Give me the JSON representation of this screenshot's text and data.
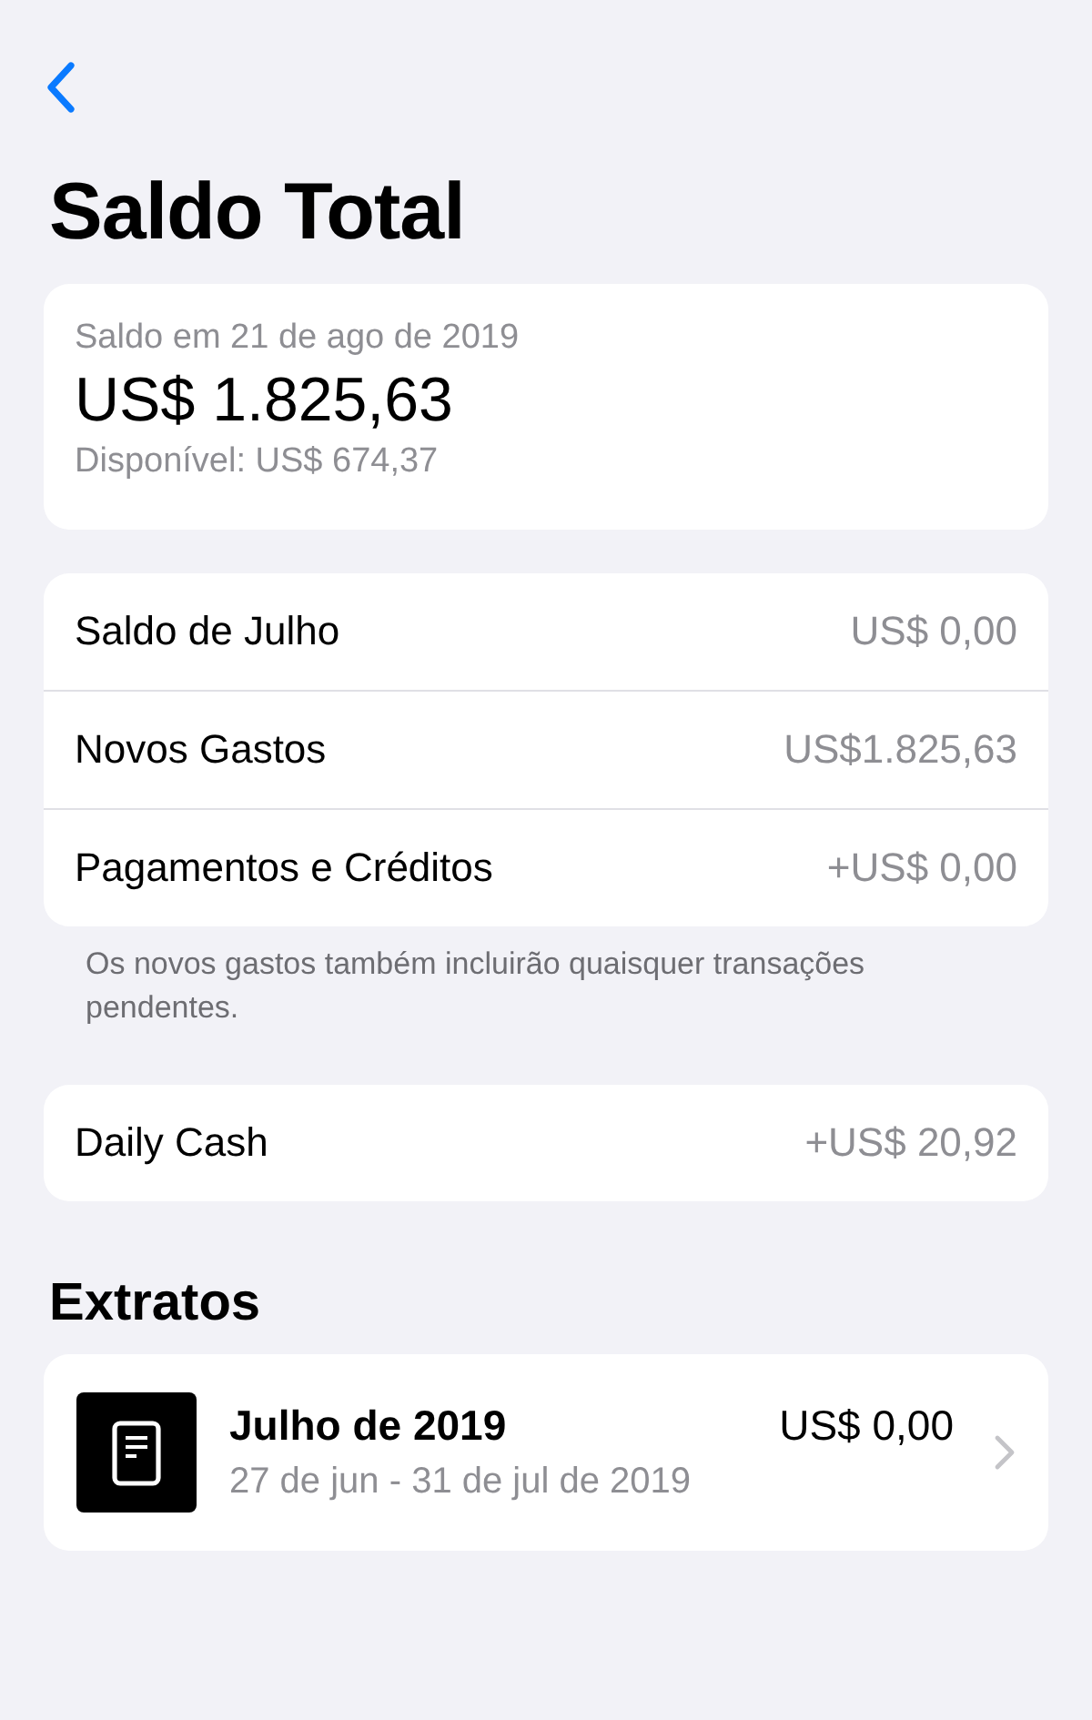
{
  "title": "Saldo Total",
  "balance": {
    "date": "Saldo em 21 de ago de 2019",
    "amount": "US$ 1.825,63",
    "available": "Disponível: US$ 674,37"
  },
  "summary": [
    {
      "label": "Saldo de Julho",
      "value": "US$ 0,00"
    },
    {
      "label": "Novos Gastos",
      "value": "US$1.825,63"
    },
    {
      "label": "Pagamentos e Créditos",
      "value": "+US$ 0,00"
    }
  ],
  "note": "Os novos gastos também incluirão quaisquer transações pendentes.",
  "daily_cash": {
    "label": "Daily Cash",
    "value": "+US$ 20,92"
  },
  "statements_heading": "Extratos",
  "statements": [
    {
      "title": "Julho de 2019",
      "amount": "US$ 0,00",
      "period": "27 de jun - 31 de jul de 2019"
    }
  ]
}
